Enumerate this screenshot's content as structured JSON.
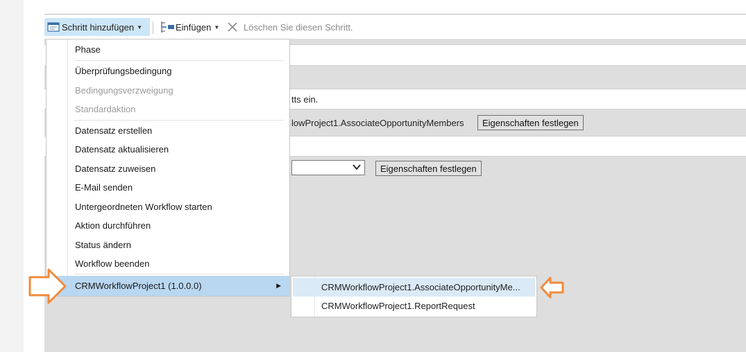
{
  "toolbar": {
    "add_step": "Schritt hinzufügen",
    "insert": "Einfügen",
    "delete": "Löschen Sie diesen Schritt."
  },
  "background": {
    "row_text_1": "tts ein.",
    "row_text_2": "lowProject1.AssociateOpportunityMembers",
    "set_properties_1": "Eigenschaften festlegen",
    "set_properties_2": "Eigenschaften festlegen"
  },
  "menu": {
    "phase": "Phase",
    "check_condition": "Überprüfungsbedingung",
    "conditional_branch": "Bedingungsverzweigung",
    "default_action": "Standardaktion",
    "create_record": "Datensatz erstellen",
    "update_record": "Datensatz aktualisieren",
    "assign_record": "Datensatz zuweisen",
    "send_email": "E-Mail senden",
    "start_child_workflow": "Untergeordneten Workflow starten",
    "perform_action": "Aktion durchführen",
    "change_status": "Status ändern",
    "stop_workflow": "Workflow beenden",
    "crm_project": "CRMWorkflowProject1 (1.0.0.0)"
  },
  "submenu": {
    "associate": "CRMWorkflowProject1.AssociateOpportunityMe...",
    "report": "CRMWorkflowProject1.ReportRequest"
  },
  "colors": {
    "highlight": "#b9d7f1",
    "annotation_arrow": "#f08a3c"
  }
}
